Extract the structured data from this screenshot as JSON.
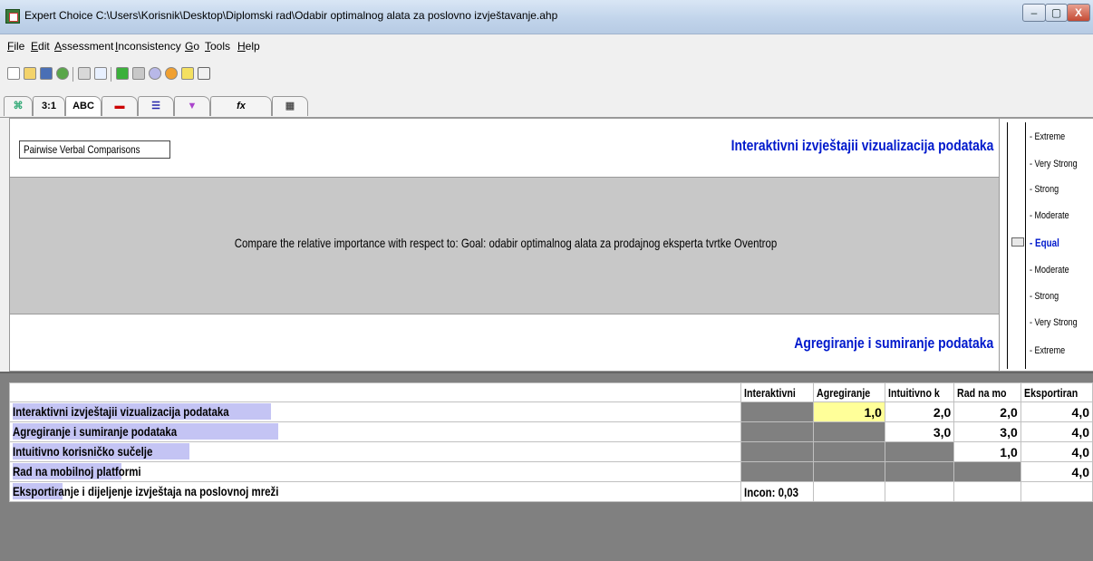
{
  "window": {
    "title": "Expert Choice    C:\\Users\\Korisnik\\Desktop\\Diplomski rad\\Odabir optimalnog alata za poslovno izvještavanje.ahp",
    "minimize": "–",
    "maximize": "▢",
    "close": "X"
  },
  "menu": [
    {
      "label": "File"
    },
    {
      "label": "Edit"
    },
    {
      "label": "Assessment"
    },
    {
      "label": "Inconsistency"
    },
    {
      "label": "Go"
    },
    {
      "label": "Tools"
    },
    {
      "label": "Help"
    }
  ],
  "tabs": [
    {
      "label": "",
      "icon": "tree-icon"
    },
    {
      "label": "3:1"
    },
    {
      "label": "ABC"
    },
    {
      "label": "",
      "icon": "bar-chart-icon"
    },
    {
      "label": "",
      "icon": "sorted-bars-icon"
    },
    {
      "label": "",
      "icon": "funnel-icon"
    },
    {
      "label": "fx"
    },
    {
      "label": "",
      "icon": "grid-icon"
    }
  ],
  "pane": {
    "mode_button": "Pairwise Verbal Comparisons",
    "element_top": "Interaktivni izvještajii vizualizacija podataka",
    "compare_text": "Compare the relative importance with respect to: Goal: odabir optimalnog alata za prodajnog eksperta tvrtke Oventrop",
    "element_bottom": "Agregiranje i sumiranje podataka"
  },
  "scale": {
    "labels": [
      "Extreme",
      "Very Strong",
      "Strong",
      "Moderate",
      "Equal",
      "Moderate",
      "Strong",
      "Very Strong",
      "Extreme"
    ],
    "selected": "Equal"
  },
  "matrix": {
    "headers": [
      "Interaktivni",
      "Agregiranje",
      "Intuitivno k",
      "Rad na mo",
      "Eksportiran"
    ],
    "rows": [
      {
        "name": "Interaktivni izvještajii vizualizacija podataka",
        "values": [
          "",
          "1,0",
          "2,0",
          "2,0",
          "4,0"
        ]
      },
      {
        "name": "Agregiranje i sumiranje podataka",
        "values": [
          "",
          "",
          "3,0",
          "3,0",
          "4,0"
        ]
      },
      {
        "name": "Intuitivno korisničko sučelje",
        "values": [
          "",
          "",
          "",
          "1,0",
          "4,0"
        ]
      },
      {
        "name": "Rad na mobilnoj platformi",
        "values": [
          "",
          "",
          "",
          "",
          "4,0"
        ]
      },
      {
        "name": "Eksportiranje i dijeljenje izvještaja na poslovnoj mreži",
        "values": [
          "Incon: 0,03",
          "",
          "",
          "",
          ""
        ]
      }
    ]
  }
}
